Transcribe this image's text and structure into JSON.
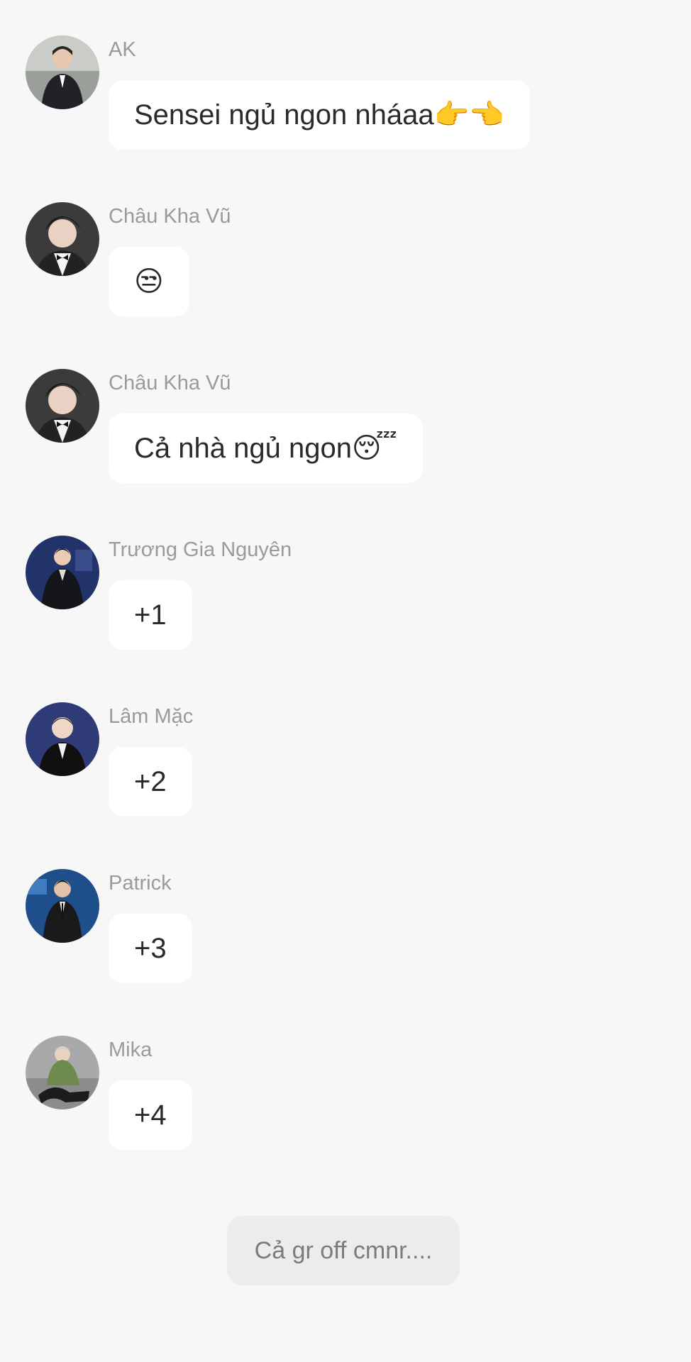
{
  "messages": [
    {
      "sender": "AK",
      "text": "Sensei ngủ ngon nháaa👉👈",
      "avatar_icon": "avatar-ak",
      "bg": "#6b6f6c"
    },
    {
      "sender": "Châu Kha Vũ",
      "text": "😒",
      "avatar_icon": "avatar-chau-kha-vu",
      "bg": "#3f3f3f"
    },
    {
      "sender": "Châu Kha Vũ",
      "text": "Cả nhà ngủ ngon😴",
      "avatar_icon": "avatar-chau-kha-vu",
      "bg": "#3f3f3f"
    },
    {
      "sender": "Trương Gia Nguyên",
      "text": "+1",
      "avatar_icon": "avatar-truong-gia-nguyen",
      "bg": "#283a73"
    },
    {
      "sender": "Lâm Mặc",
      "text": "+2",
      "avatar_icon": "avatar-lam-mac",
      "bg": "#2d3b78"
    },
    {
      "sender": "Patrick",
      "text": "+3",
      "avatar_icon": "avatar-patrick",
      "bg": "#23548e"
    },
    {
      "sender": "Mika",
      "text": "+4",
      "avatar_icon": "avatar-mika",
      "bg": "#9e9e9e"
    }
  ],
  "system_notice": "Cả gr off cmnr....",
  "colors": {
    "background": "#f7f7f8",
    "bubble": "#ffffff",
    "sender_text": "#9a9a9a",
    "system_bubble": "#ececee"
  }
}
